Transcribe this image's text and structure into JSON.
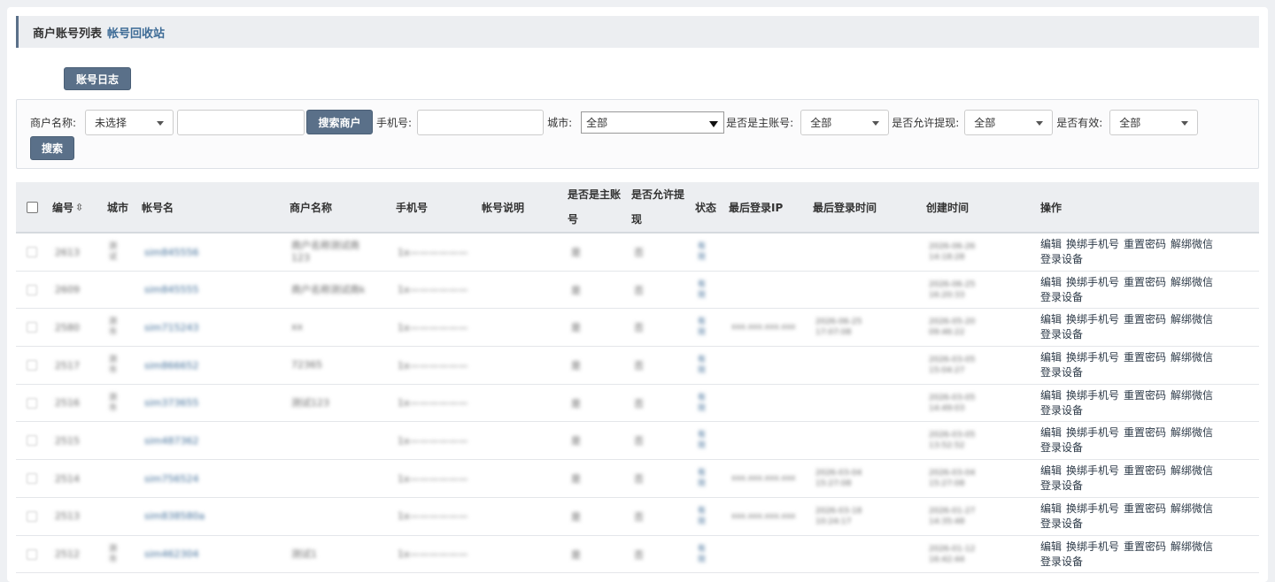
{
  "header": {
    "title": "商户账号列表",
    "recycle_link": "帐号回收站"
  },
  "log_button": "账号日志",
  "filters": {
    "merchant_label": "商户名称:",
    "merchant_select": "未选择",
    "search_merchant_button": "搜索商户",
    "phone_label": "手机号:",
    "city_label": "城市:",
    "city_select": "全部",
    "is_main_label": "是否是主账号:",
    "is_main_select": "全部",
    "allow_withdraw_label": "是否允许提现:",
    "allow_withdraw_select": "全部",
    "valid_label": "是否有效:",
    "valid_select": "全部",
    "search_button": "搜索"
  },
  "table": {
    "headers": {
      "id": "编号",
      "city": "城市",
      "account": "帐号名",
      "merchant": "商户名称",
      "phone": "手机号",
      "desc": "帐号说明",
      "is_main_1": "是否是主账",
      "is_main_2": "号",
      "withdraw_1": "是否允许提",
      "withdraw_2": "现",
      "status": "状态",
      "last_ip": "最后登录IP",
      "last_time": "最后登录时间",
      "created": "创建时间",
      "ops": "操作"
    },
    "op_labels": {
      "edit": "编辑",
      "rebind_phone": "换绑手机号",
      "reset_password": "重置密码",
      "unbind_wechat": "解绑微信",
      "login_device": "登录设备"
    },
    "rows": [
      {
        "id": "2613",
        "city1": "测",
        "city2": "试",
        "account": "sim845556",
        "merchant1": "商户名称测试商",
        "merchant2": "123",
        "phone": "1x——————",
        "is_main": "是",
        "withdraw": "否",
        "st1": "有",
        "st2": "效",
        "ip": "",
        "lt1": "",
        "lt2": "",
        "ct1": "2026-06-26",
        "ct2": "14:18:28"
      },
      {
        "id": "2609",
        "city1": "",
        "city2": "",
        "account": "sim845555",
        "merchant1": "商户名称测试商k",
        "merchant2": "",
        "phone": "1x——————",
        "is_main": "是",
        "withdraw": "否",
        "st1": "有",
        "st2": "效",
        "ip": "",
        "lt1": "",
        "lt2": "",
        "ct1": "2026-06-25",
        "ct2": "16:20:33"
      },
      {
        "id": "2580",
        "city1": "测",
        "city2": "市",
        "account": "sim715243",
        "merchant1": "xx",
        "merchant2": "",
        "phone": "1x——————",
        "is_main": "是",
        "withdraw": "否",
        "st1": "有",
        "st2": "效",
        "ip": "xxx.xxx.xxx.xxx",
        "lt1": "2026-06-25",
        "lt2": "17:07:08",
        "ct1": "2026-05-20",
        "ct2": "09:46:22"
      },
      {
        "id": "2517",
        "city1": "测",
        "city2": "市",
        "account": "sim866652",
        "merchant1": "72365",
        "merchant2": "",
        "phone": "1x——————",
        "is_main": "是",
        "withdraw": "否",
        "st1": "有",
        "st2": "效",
        "ip": "",
        "lt1": "",
        "lt2": "",
        "ct1": "2026-03-05",
        "ct2": "15:04:27"
      },
      {
        "id": "2516",
        "city1": "测",
        "city2": "市",
        "account": "sim373655",
        "merchant1": "测试123",
        "merchant2": "",
        "phone": "1x——————",
        "is_main": "是",
        "withdraw": "否",
        "st1": "有",
        "st2": "效",
        "ip": "",
        "lt1": "",
        "lt2": "",
        "ct1": "2026-03-05",
        "ct2": "14:49:03"
      },
      {
        "id": "2515",
        "city1": "",
        "city2": "",
        "account": "sim487362",
        "merchant1": "",
        "merchant2": "",
        "phone": "1x——————",
        "is_main": "是",
        "withdraw": "否",
        "st1": "有",
        "st2": "效",
        "ip": "",
        "lt1": "",
        "lt2": "",
        "ct1": "2026-03-05",
        "ct2": "13:52:52"
      },
      {
        "id": "2514",
        "city1": "",
        "city2": "",
        "account": "sim756524",
        "merchant1": "",
        "merchant2": "",
        "phone": "1x——————",
        "is_main": "是",
        "withdraw": "否",
        "st1": "有",
        "st2": "效",
        "ip": "xxx.xxx.xxx.xxx",
        "lt1": "2026-03-04",
        "lt2": "15:27:08",
        "ct1": "2026-03-04",
        "ct2": "15:27:08"
      },
      {
        "id": "2513",
        "city1": "",
        "city2": "",
        "account": "sim838580a",
        "merchant1": "",
        "merchant2": "",
        "phone": "1x——————",
        "is_main": "是",
        "withdraw": "否",
        "st1": "有",
        "st2": "效",
        "ip": "xxx.xxx.xxx.xxx",
        "lt1": "2026-03-18",
        "lt2": "10:24:17",
        "ct1": "2026-01-27",
        "ct2": "14:35:48"
      },
      {
        "id": "2512",
        "city1": "测",
        "city2": "市",
        "account": "sim462304",
        "merchant1": "测试1",
        "merchant2": "",
        "phone": "1x——————",
        "is_main": "是",
        "withdraw": "否",
        "st1": "有",
        "st2": "效",
        "ip": "",
        "lt1": "",
        "lt2": "",
        "ct1": "2026-01-12",
        "ct2": "16:42:44"
      }
    ]
  }
}
